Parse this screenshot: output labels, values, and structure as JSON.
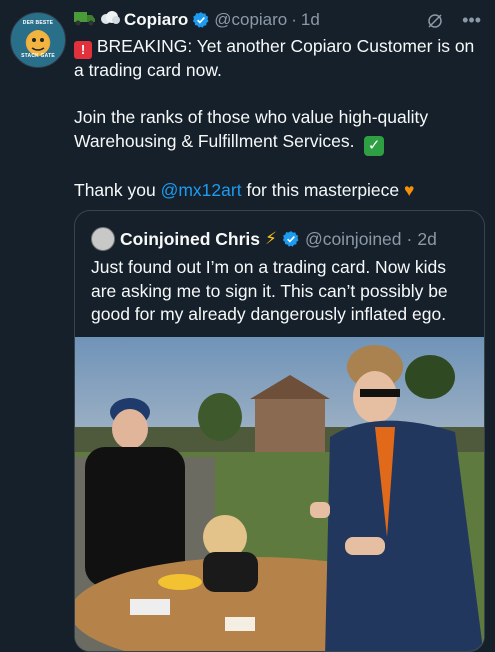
{
  "tweet": {
    "author_name": "Copiaro",
    "author_handle": "@copiaro",
    "time": "1d",
    "line1": "BREAKING: Yet another Copiaro Customer is on a trading card now.",
    "line2": "Join the ranks of those who value high-quality Warehousing & Fulfillment Services.",
    "thank_prefix": "Thank you",
    "mention": "@mx12art",
    "thank_suffix": "for this masterpiece",
    "avatar_top_text": "DER BESTE",
    "avatar_bottom_text": "STACK GATE"
  },
  "quote": {
    "author_name": "Coinjoined Chris",
    "author_handle": "@coinjoined",
    "time": "2d",
    "text": "Just found out I’m on a trading card. Now kids are asking me to sign it. This can’t possibly be good for my already dangerously inflated ego."
  },
  "icons": [
    "truck-icon",
    "cloud-icon",
    "verified-icon",
    "grok-icon",
    "more-icon",
    "alert-icon",
    "check-icon",
    "heart-icon",
    "bolt-icon"
  ],
  "colors": {
    "background": "#15202b",
    "accent": "#1d9bf0",
    "muted": "#8b98a5",
    "border": "#38444d"
  }
}
